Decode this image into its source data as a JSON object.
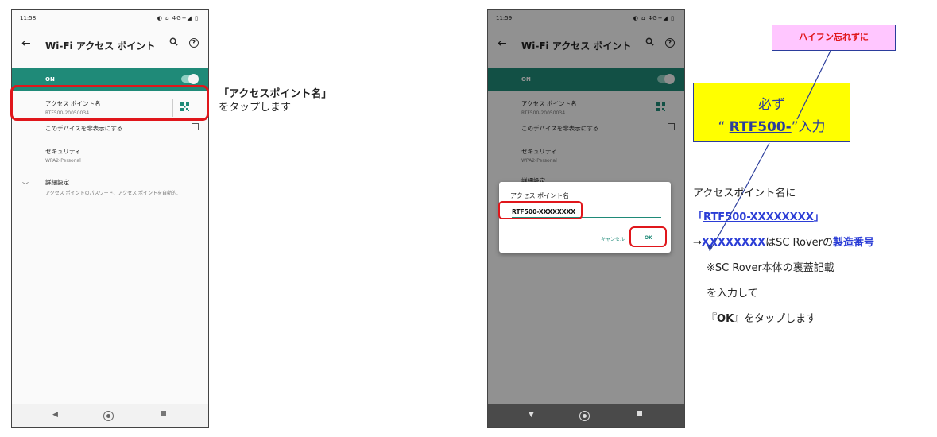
{
  "left_phone": {
    "status_time": "11:58",
    "status_icons": "◐ ⌂ 4G+◢ ▯",
    "back_icon": "←",
    "title": "Wi-Fi アクセス ポイント",
    "search_icon": "🔍",
    "help_icon": "?",
    "on_label": "ON",
    "ap_name_label": "アクセス ポイント名",
    "ap_name_value": "RTF500-20050034",
    "hide_device_label": "このデバイスを非表示にする",
    "security_label": "セキュリティ",
    "security_value": "WPA2-Personal",
    "advanced_label": "詳細設定",
    "advanced_value": "アクセス ポイントのパスワード、アクセス ポイントを自動的."
  },
  "right_phone": {
    "status_time": "11:59",
    "status_icons": "◐ ⌂ 4G+◢ ▯",
    "title": "Wi-Fi アクセス ポイント",
    "on_label": "ON",
    "ap_name_label": "アクセス ポイント名",
    "ap_name_value": "RTF500-20050034",
    "hide_device_label": "このデバイスを非表示にする",
    "security_label": "セキュリティ",
    "security_value": "WPA2-Personal",
    "advanced_label": "詳細設定",
    "dialog": {
      "title": "アクセス ポイント名",
      "input_value": "RTF500-XXXXXXXX",
      "cancel_label": "キャンセル",
      "ok_label": "OK"
    }
  },
  "nav": {
    "back": "◀",
    "home": "●",
    "recent": "■",
    "back_dark": "▼"
  },
  "instructions_left": {
    "line1": "「アクセスポイント名」",
    "line2": "をタップします"
  },
  "callouts": {
    "pink": "ハイフン忘れずに",
    "yellow_line1": "必ず",
    "yellow_quote_open": "“ ",
    "yellow_rtf": "RTF500-",
    "yellow_quote_close": "”入力"
  },
  "instructions_right": {
    "line1": "アクセスポイント名に",
    "line2_open": "「",
    "line2_value": "RTF500-XXXXXXXX",
    "line2_close": "」",
    "line3_arrow": "→",
    "line3_x": "XXXXXXXX",
    "line3_mid": "はSC Roverの",
    "line3_serial": "製造番号",
    "line4": "※SC Rover本体の裏蓋記載",
    "line5": "を入力して",
    "line6_open": "『",
    "line6_ok": "OK",
    "line6_rest": "』をタップします"
  },
  "colors": {
    "teal": "#1f8a78",
    "red_highlight": "#e0161b",
    "callout_blue": "#2b3d9c",
    "pink": "#ffc6ff",
    "yellow": "#ffff00"
  }
}
